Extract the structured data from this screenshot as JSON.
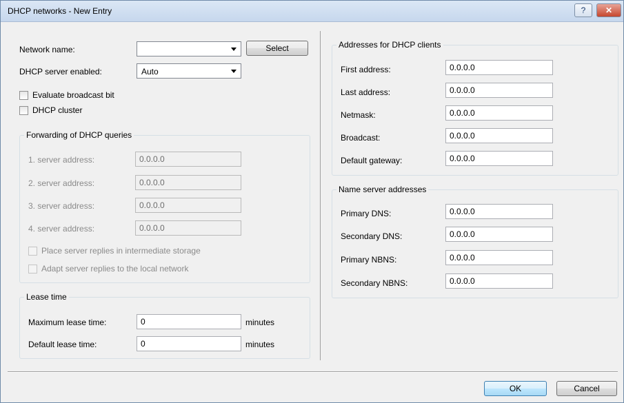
{
  "window": {
    "title": "DHCP networks - New Entry",
    "help_btn": "?",
    "close_btn": "✕"
  },
  "left": {
    "network_name_label": "Network name:",
    "network_name_value": "",
    "select_btn": "Select",
    "dhcp_enabled_label": "DHCP server enabled:",
    "dhcp_enabled_value": "Auto",
    "evaluate_broadcast": "Evaluate broadcast bit",
    "dhcp_cluster": "DHCP cluster"
  },
  "forwarding": {
    "title": "Forwarding of DHCP queries",
    "servers": [
      {
        "label": "1. server address:",
        "value": "0.0.0.0"
      },
      {
        "label": "2. server address:",
        "value": "0.0.0.0"
      },
      {
        "label": "3. server address:",
        "value": "0.0.0.0"
      },
      {
        "label": "4. server address:",
        "value": "0.0.0.0"
      }
    ],
    "place_replies": "Place server replies in intermediate storage",
    "adapt_replies": "Adapt server replies to the local network"
  },
  "lease": {
    "title": "Lease time",
    "max_label": "Maximum lease time:",
    "max_value": "0",
    "default_label": "Default lease time:",
    "default_value": "0",
    "unit": "minutes"
  },
  "addresses": {
    "title": "Addresses for DHCP clients",
    "fields": [
      {
        "label": "First address:",
        "value": "0.0.0.0"
      },
      {
        "label": "Last address:",
        "value": "0.0.0.0"
      },
      {
        "label": "Netmask:",
        "value": "0.0.0.0"
      },
      {
        "label": "Broadcast:",
        "value": "0.0.0.0"
      },
      {
        "label": "Default gateway:",
        "value": "0.0.0.0"
      }
    ]
  },
  "nameservers": {
    "title": "Name server addresses",
    "fields": [
      {
        "label": "Primary DNS:",
        "value": "0.0.0.0"
      },
      {
        "label": "Secondary DNS:",
        "value": "0.0.0.0"
      },
      {
        "label": "Primary NBNS:",
        "value": "0.0.0.0"
      },
      {
        "label": "Secondary NBNS:",
        "value": "0.0.0.0"
      }
    ]
  },
  "footer": {
    "ok": "OK",
    "cancel": "Cancel"
  }
}
